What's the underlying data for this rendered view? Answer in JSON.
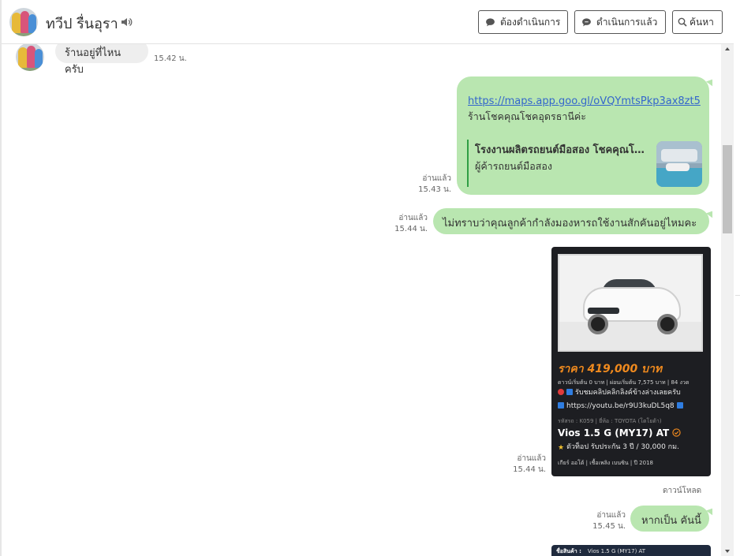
{
  "header": {
    "contact_name": "ทวีป รื่นอุรา",
    "buttons": {
      "todo": "ต้องดำเนินการ",
      "done": "ดำเนินการแล้ว",
      "search": "ค้นหา"
    }
  },
  "messages": {
    "m1": {
      "text": "ร้านอยู่ที่ไหนครับ",
      "time": "15.42 น."
    },
    "m2": {
      "link": "https://maps.app.goo.gl/oVQYmtsPkp3ax8zt5",
      "text": "ร้านโชคคุณโชคอุดรธานีค่ะ",
      "preview_title": "โรงงานผลิตรถยนต์มือสอง โชคคุณโชค",
      "preview_subtitle": "ผู้ค้ารถยนต์มือสอง",
      "read": "อ่านแล้ว",
      "time": "15.43 น."
    },
    "m3": {
      "text": "ไม่ทราบว่าคุณลูกค้ากำลังมองหารถใช้งานสักคันอยู่ไหมคะ",
      "read": "อ่านแล้ว",
      "time": "15.44 น."
    },
    "m4": {
      "read": "อ่านแล้ว",
      "time": "15.44 น.",
      "download": "ดาวน์โหลด",
      "card": {
        "price": "ราคา 419,000 บาท",
        "finance": "ดาวน์เริ่มต้น 0 บาท | ผ่อนเริ่มต้น 7,575 บาท | 84 งวด",
        "clip": "รับชมคลิปคลิกลิงค์ข้างล่างเลยครับ",
        "youtube": "https://youtu.be/r9U3kuDL5q8",
        "code": "รหัสรถ : K059 | ยี่ห้อ : TOYOTA (โตโยต้า)",
        "model": "Vios 1.5 G (MY17) AT",
        "warranty": "ตัวท็อป รับประกัน 3 ปี / 30,000 กม.",
        "specs": "เกียร์ ออโต้ | เชื้อเพลิง เบนซิน | ปี 2018"
      }
    },
    "m5": {
      "text": "หากเป็น คันนี้",
      "read": "อ่านแล้ว",
      "time": "15.45 น."
    },
    "m6": {
      "label": "ชื่อสินค้า :",
      "value": "Vios 1.5 G (MY17) AT"
    }
  },
  "colors": {
    "outgoing_bubble": "#b9e6b0",
    "incoming_bubble": "#eeeeee",
    "link": "#3366cc",
    "price": "#f08a1e"
  },
  "icons": [
    "speaker-icon",
    "chat-bubble-icon",
    "search-icon",
    "check-circle-icon"
  ]
}
